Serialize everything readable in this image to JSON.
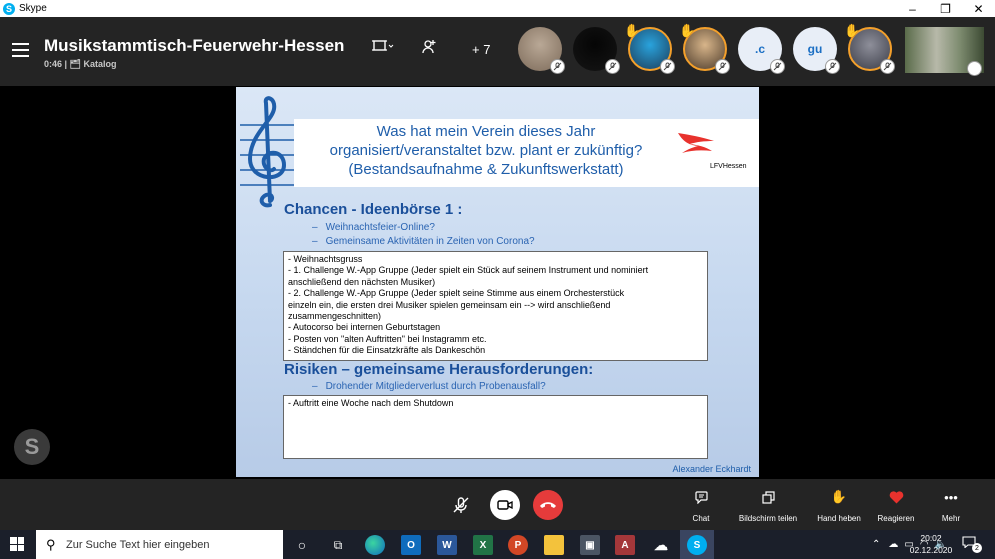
{
  "window": {
    "app_title": "Skype",
    "controls": {
      "minimize": "–",
      "maximize": "❐",
      "close": "✕"
    }
  },
  "call": {
    "title": "Musikstammtisch-Feuerwehr-Hessen",
    "subtitle": "0:46 | 🗂 Katalog",
    "more_participants": "+ 7",
    "participants": [
      {
        "kind": "photo",
        "colors": [
          "#b9a896",
          "#7d6b5a"
        ],
        "raised_hand": false,
        "ring": false
      },
      {
        "kind": "photo",
        "colors": [
          "#050505",
          "#151515"
        ],
        "raised_hand": false,
        "ring": false
      },
      {
        "kind": "photo",
        "colors": [
          "#29a3dd",
          "#1c3d5a"
        ],
        "raised_hand": true,
        "ring": true
      },
      {
        "kind": "photo",
        "colors": [
          "#d8b58a",
          "#4b3a2a"
        ],
        "raised_hand": true,
        "ring": true
      },
      {
        "kind": "initials",
        "initials": ".c",
        "raised_hand": false,
        "ring": false
      },
      {
        "kind": "initials",
        "initials": "gu",
        "raised_hand": false,
        "ring": false
      },
      {
        "kind": "photo",
        "colors": [
          "#8e8f9a",
          "#3a3c47"
        ],
        "raised_hand": true,
        "ring": true
      }
    ]
  },
  "slide": {
    "title_lines": [
      "Was hat mein Verein dieses Jahr",
      "organisiert/veranstaltet bzw. plant er zukünftig?",
      "(Bestandsaufnahme & Zukunftswerkstatt)"
    ],
    "logo_text": "LFVHessen",
    "section1": {
      "heading": "Chancen - Ideenbörse 1 :",
      "bullets": [
        "Weihnachtsfeier-Online?",
        "Gemeinsame Aktivitäten in Zeiten von Corona?"
      ],
      "notes": [
        "- Weihnachtsgruss",
        "- 1. Challenge W.-App Gruppe (Jeder spielt ein Stück auf seinem Instrument und nominiert",
        "anschließend den nächsten Musiker)",
        "- 2. Challenge W.-App Gruppe (Jeder spielt seine Stimme aus einem Orchesterstück",
        "einzeln ein, die ersten drei Musiker spielen gemeinsam ein --> wird anschließend",
        "zusammengeschnitten)",
        "- Autocorso bei internen Geburtstagen",
        "- Posten von \"alten Auftritten\" bei Instagramm etc.",
        "- Ständchen für die Einsatzkräfte als Dankeschön"
      ]
    },
    "section2": {
      "heading": "Risiken – gemeinsame Herausforderungen:",
      "bullets": [
        "Drohender Mitgliederverlust durch Probenausfall?"
      ],
      "notes": [
        "- Auftritt eine Woche nach dem Shutdown"
      ]
    },
    "author": "Alexander Eckhardt"
  },
  "controls": {
    "chat": "Chat",
    "share": "Bildschirm teilen",
    "raise_hand": "Hand heben",
    "react": "Reagieren",
    "more": "Mehr"
  },
  "taskbar": {
    "search_placeholder": "Zur Suche Text hier eingeben",
    "time": "20:02",
    "date": "02.12.2020",
    "notification_count": "2"
  },
  "colors": {
    "accent_orange": "#f4a02b",
    "hangup_red": "#e63b3b",
    "heart_red": "#e8322d",
    "slide_blue": "#1f5eaa"
  }
}
